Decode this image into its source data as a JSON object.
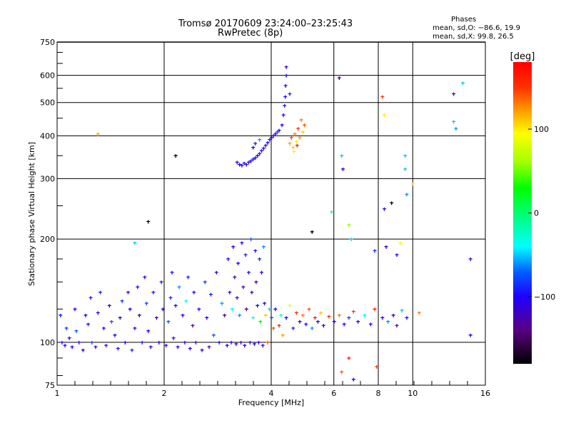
{
  "header": {
    "title_line1": "Tromsø 20170609 23:24:00–23:25:43",
    "title_line2": "RwPretec (8p)",
    "stats_title": "Phases",
    "stats_o": "mean, sd,O: −86.6, 19.9",
    "stats_x": "mean, sd,X:  99.8, 26.5"
  },
  "colorbar": {
    "label": "[deg]",
    "range": [
      -180,
      180
    ],
    "ticks": [
      100,
      0,
      -100
    ],
    "tick_labels": [
      "100",
      "0",
      "−100"
    ],
    "colors": [
      "#000000",
      "#5a0080",
      "#2000ff",
      "#0060ff",
      "#00ffff",
      "#00ff70",
      "#00ff00",
      "#a0ff00",
      "#ffff00",
      "#ff9000",
      "#ff3000",
      "#ff0000"
    ]
  },
  "chart_data": {
    "type": "scatter",
    "xlabel": "Frequency [MHz]",
    "ylabel": "Stationary phase Virtual Height [km]",
    "x_scale": "log",
    "y_scale": "log",
    "xlim": [
      1,
      16
    ],
    "ylim": [
      75,
      750
    ],
    "x_ticks": [
      1,
      2,
      4,
      6,
      8,
      10,
      16
    ],
    "x_tick_labels": [
      "1",
      "2",
      "4",
      "6",
      "8",
      "10",
      "16"
    ],
    "y_ticks": [
      75,
      100,
      200,
      300,
      400,
      500,
      600,
      750
    ],
    "y_tick_labels": [
      "75",
      "100",
      "200",
      "300",
      "400",
      "500",
      "600",
      "750"
    ],
    "grid": true,
    "grid_x": [
      2,
      4,
      6,
      8,
      10
    ],
    "grid_y": [
      100,
      200,
      300,
      400,
      500,
      600
    ],
    "point_fields": [
      "frequency_mhz",
      "height_km",
      "phase_deg"
    ],
    "points": [
      [
        1.02,
        120,
        -90
      ],
      [
        1.03,
        100,
        -95
      ],
      [
        1.05,
        98,
        -100
      ],
      [
        1.06,
        110,
        -80
      ],
      [
        1.08,
        103,
        -110
      ],
      [
        1.1,
        97,
        -100
      ],
      [
        1.12,
        125,
        -100
      ],
      [
        1.13,
        108,
        -70
      ],
      [
        1.15,
        100,
        -95
      ],
      [
        1.18,
        95,
        -105
      ],
      [
        1.2,
        120,
        -100
      ],
      [
        1.22,
        113,
        -110
      ],
      [
        1.24,
        135,
        -95
      ],
      [
        1.25,
        100,
        -80
      ],
      [
        1.28,
        97,
        -110
      ],
      [
        1.3,
        122,
        -100
      ],
      [
        1.32,
        140,
        -90
      ],
      [
        1.35,
        110,
        -100
      ],
      [
        1.37,
        98,
        -105
      ],
      [
        1.4,
        128,
        -110
      ],
      [
        1.42,
        115,
        -70
      ],
      [
        1.45,
        105,
        -100
      ],
      [
        1.48,
        96,
        -95
      ],
      [
        1.5,
        118,
        -110
      ],
      [
        1.52,
        132,
        -85
      ],
      [
        1.55,
        100,
        -100
      ],
      [
        1.58,
        140,
        -120
      ],
      [
        1.6,
        125,
        -100
      ],
      [
        1.62,
        95,
        -90
      ],
      [
        1.65,
        110,
        -105
      ],
      [
        1.68,
        145,
        -100
      ],
      [
        1.7,
        120,
        -130
      ],
      [
        1.73,
        100,
        -95
      ],
      [
        1.76,
        155,
        -100
      ],
      [
        1.78,
        130,
        -80
      ],
      [
        1.8,
        108,
        -100
      ],
      [
        1.83,
        97,
        -110
      ],
      [
        1.86,
        140,
        -95
      ],
      [
        1.9,
        118,
        -130
      ],
      [
        1.93,
        100,
        -100
      ],
      [
        1.96,
        150,
        -90
      ],
      [
        1.98,
        125,
        -100
      ],
      [
        2.02,
        98,
        -100
      ],
      [
        2.05,
        115,
        -70
      ],
      [
        2.08,
        135,
        -90
      ],
      [
        2.1,
        160,
        -100
      ],
      [
        2.12,
        103,
        -95
      ],
      [
        2.15,
        128,
        -110
      ],
      [
        2.18,
        97,
        -100
      ],
      [
        2.2,
        145,
        -60
      ],
      [
        2.25,
        120,
        -100
      ],
      [
        2.28,
        100,
        -110
      ],
      [
        2.3,
        132,
        -40
      ],
      [
        2.33,
        155,
        -90
      ],
      [
        2.36,
        96,
        -100
      ],
      [
        2.4,
        112,
        -130
      ],
      [
        2.42,
        140,
        -100
      ],
      [
        2.45,
        100,
        -120
      ],
      [
        2.5,
        125,
        -95
      ],
      [
        2.55,
        95,
        -100
      ],
      [
        2.6,
        150,
        -80
      ],
      [
        2.63,
        118,
        -100
      ],
      [
        2.67,
        97,
        -130
      ],
      [
        2.7,
        138,
        -95
      ],
      [
        2.75,
        105,
        -70
      ],
      [
        2.8,
        160,
        -110
      ],
      [
        2.85,
        100,
        -100
      ],
      [
        2.9,
        130,
        -60
      ],
      [
        2.95,
        120,
        -140
      ],
      [
        3.0,
        98,
        -100
      ],
      [
        3.02,
        175,
        -100
      ],
      [
        3.05,
        140,
        -120
      ],
      [
        3.08,
        100,
        -110
      ],
      [
        3.1,
        125,
        -40
      ],
      [
        3.12,
        190,
        -100
      ],
      [
        3.15,
        155,
        -130
      ],
      [
        3.18,
        99,
        -100
      ],
      [
        3.2,
        135,
        -110
      ],
      [
        3.22,
        170,
        -95
      ],
      [
        3.25,
        120,
        -60
      ],
      [
        3.28,
        100,
        -120
      ],
      [
        3.3,
        195,
        -100
      ],
      [
        3.33,
        145,
        -130
      ],
      [
        3.36,
        98,
        -100
      ],
      [
        3.38,
        180,
        -90
      ],
      [
        3.4,
        125,
        -140
      ],
      [
        3.45,
        160,
        -100
      ],
      [
        3.48,
        100,
        -110
      ],
      [
        3.5,
        200,
        -80
      ],
      [
        3.52,
        140,
        -120
      ],
      [
        3.55,
        118,
        -40
      ],
      [
        3.58,
        99,
        -100
      ],
      [
        3.6,
        185,
        -95
      ],
      [
        3.62,
        150,
        -130
      ],
      [
        3.65,
        128,
        -100
      ],
      [
        3.68,
        100,
        -110
      ],
      [
        3.7,
        175,
        -90
      ],
      [
        3.72,
        115,
        30
      ],
      [
        3.75,
        160,
        -100
      ],
      [
        3.78,
        98,
        -110
      ],
      [
        3.8,
        190,
        -60
      ],
      [
        3.82,
        130,
        -100
      ],
      [
        3.85,
        120,
        110
      ],
      [
        3.9,
        100,
        140
      ],
      [
        3.95,
        125,
        -50
      ],
      [
        4.0,
        118,
        -70
      ],
      [
        4.05,
        110,
        140
      ],
      [
        4.1,
        125,
        -100
      ],
      [
        4.2,
        112,
        160
      ],
      [
        4.25,
        120,
        -30
      ],
      [
        4.3,
        105,
        120
      ],
      [
        4.4,
        118,
        -100
      ],
      [
        4.5,
        128,
        90
      ],
      [
        4.6,
        110,
        -90
      ],
      [
        4.7,
        122,
        150
      ],
      [
        4.8,
        115,
        -110
      ],
      [
        4.9,
        120,
        130
      ],
      [
        5.0,
        113,
        -100
      ],
      [
        5.1,
        125,
        140
      ],
      [
        5.2,
        110,
        -60
      ],
      [
        5.3,
        118,
        160
      ],
      [
        5.4,
        115,
        -110
      ],
      [
        5.5,
        122,
        110
      ],
      [
        5.6,
        112,
        -100
      ],
      [
        5.8,
        119,
        150
      ],
      [
        6.0,
        115,
        -110
      ],
      [
        6.2,
        120,
        130
      ],
      [
        6.4,
        113,
        -100
      ],
      [
        6.6,
        118,
        -80
      ],
      [
        6.8,
        123,
        150
      ],
      [
        7.0,
        115,
        -110
      ],
      [
        7.3,
        120,
        -40
      ],
      [
        7.6,
        113,
        -100
      ],
      [
        7.8,
        125,
        160
      ],
      [
        8.2,
        118,
        -110
      ],
      [
        8.5,
        115,
        -60
      ],
      [
        8.8,
        120,
        -100
      ],
      [
        9.0,
        112,
        -120
      ],
      [
        9.3,
        124,
        -50
      ],
      [
        9.6,
        118,
        -100
      ],
      [
        10.4,
        122,
        130
      ],
      [
        3.2,
        335,
        -100
      ],
      [
        3.25,
        330,
        -110
      ],
      [
        3.3,
        328,
        -100
      ],
      [
        3.35,
        333,
        -95
      ],
      [
        3.4,
        330,
        -100
      ],
      [
        3.45,
        335,
        -110
      ],
      [
        3.5,
        338,
        -100
      ],
      [
        3.55,
        342,
        -90
      ],
      [
        3.6,
        345,
        -100
      ],
      [
        3.65,
        350,
        -110
      ],
      [
        3.7,
        355,
        -100
      ],
      [
        3.75,
        362,
        -95
      ],
      [
        3.8,
        368,
        -100
      ],
      [
        3.85,
        375,
        -110
      ],
      [
        3.9,
        382,
        -100
      ],
      [
        3.95,
        390,
        -95
      ],
      [
        4.0,
        395,
        -100
      ],
      [
        4.05,
        400,
        -110
      ],
      [
        4.1,
        405,
        -100
      ],
      [
        4.15,
        410,
        -80
      ],
      [
        4.2,
        415,
        -100
      ],
      [
        4.28,
        430,
        -110
      ],
      [
        4.32,
        460,
        -100
      ],
      [
        4.35,
        490,
        -90
      ],
      [
        4.37,
        520,
        -100
      ],
      [
        4.38,
        560,
        -110
      ],
      [
        4.4,
        600,
        -100
      ],
      [
        4.4,
        635,
        -120
      ],
      [
        3.55,
        370,
        -100
      ],
      [
        3.6,
        380,
        -90
      ],
      [
        3.7,
        390,
        -60
      ],
      [
        4.5,
        380,
        120
      ],
      [
        4.55,
        395,
        140
      ],
      [
        4.6,
        370,
        110
      ],
      [
        4.65,
        405,
        130
      ],
      [
        4.7,
        385,
        100
      ],
      [
        4.75,
        420,
        150
      ],
      [
        4.8,
        395,
        120
      ],
      [
        4.85,
        445,
        130
      ],
      [
        4.9,
        410,
        110
      ],
      [
        4.95,
        430,
        140
      ],
      [
        4.62,
        360,
        90
      ],
      [
        4.72,
        375,
        160
      ],
      [
        1.3,
        405,
        120
      ],
      [
        2.15,
        350,
        -180
      ],
      [
        1.8,
        225,
        -180
      ],
      [
        1.65,
        195,
        -50
      ],
      [
        4.5,
        530,
        -90
      ],
      [
        6.2,
        590,
        -150
      ],
      [
        6.3,
        350,
        -50
      ],
      [
        6.35,
        320,
        -100
      ],
      [
        5.9,
        240,
        -30
      ],
      [
        6.6,
        220,
        60
      ],
      [
        6.7,
        200,
        -50
      ],
      [
        7.8,
        185,
        -90
      ],
      [
        8.2,
        520,
        150
      ],
      [
        8.3,
        460,
        100
      ],
      [
        8.3,
        245,
        -110
      ],
      [
        8.7,
        255,
        -180
      ],
      [
        9.5,
        350,
        -50
      ],
      [
        9.5,
        320,
        -50
      ],
      [
        9.6,
        270,
        -60
      ],
      [
        10.0,
        290,
        100
      ],
      [
        13.0,
        530,
        -130
      ],
      [
        13.0,
        440,
        -50
      ],
      [
        13.2,
        420,
        -60
      ],
      [
        13.8,
        570,
        -50
      ],
      [
        14.5,
        175,
        -120
      ],
      [
        14.5,
        105,
        -100
      ],
      [
        6.6,
        90,
        160
      ],
      [
        6.3,
        82,
        140
      ],
      [
        6.8,
        78,
        -100
      ],
      [
        7.9,
        85,
        150
      ],
      [
        5.2,
        210,
        -180
      ],
      [
        9.2,
        195,
        90
      ],
      [
        9.0,
        180,
        -100
      ],
      [
        8.4,
        190,
        -120
      ]
    ]
  }
}
